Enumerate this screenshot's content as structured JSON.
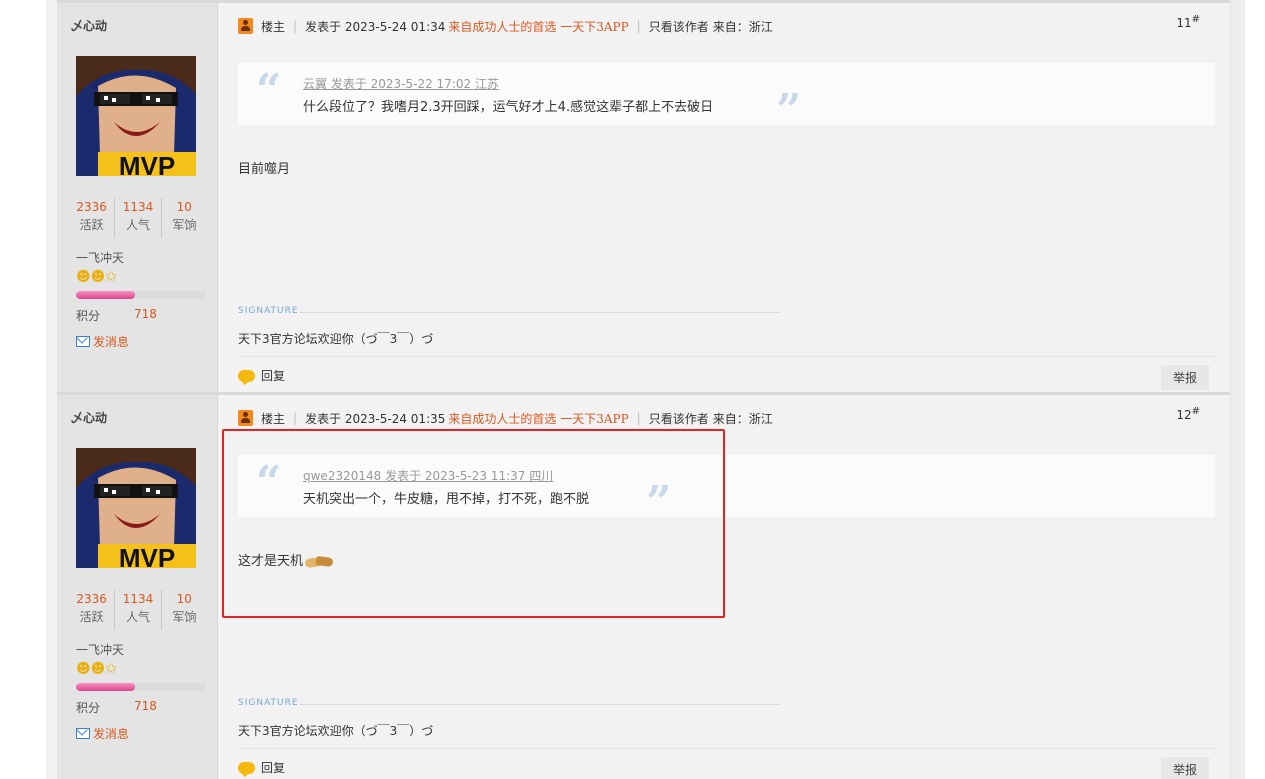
{
  "posts": [
    {
      "author": {
        "name": "乄心动",
        "stats": [
          {
            "value": "2336",
            "label": "活跃"
          },
          {
            "value": "1134",
            "label": "人气"
          },
          {
            "value": "10",
            "label": "军饷"
          }
        ],
        "rank_title": "一飞冲天",
        "rank_icons": "☻☻✩",
        "rank_progress_percent": 45,
        "score_label": "积分",
        "score_value": "718",
        "send_message": "发消息",
        "avatar_text": "MVP"
      },
      "owner_label": "楼主",
      "posted_at": "发表于 2023-5-24 01:34",
      "ad_text": "来自成功人士的首选 一天下3APP",
      "author_only": "只看该作者",
      "location": "来自：浙江",
      "floor_number": "11",
      "floor_mark": "#",
      "quote": {
        "meta": "云翼 发表于 2023-5-22 17:02 江苏",
        "text": "什么段位了？我嗜月2.3开回踩，运气好才上4.感觉这辈子都上不去破日"
      },
      "body": "目前噬月",
      "signature_label": "SIGNATURE",
      "signature": "天下3官方论坛欢迎你（づ￣3￣）づ",
      "reply_label": "回复",
      "report_label": "举报"
    },
    {
      "author": {
        "name": "乄心动",
        "stats": [
          {
            "value": "2336",
            "label": "活跃"
          },
          {
            "value": "1134",
            "label": "人气"
          },
          {
            "value": "10",
            "label": "军饷"
          }
        ],
        "rank_title": "一飞冲天",
        "rank_icons": "☻☻✩",
        "rank_progress_percent": 45,
        "score_label": "积分",
        "score_value": "718",
        "send_message": "发消息",
        "avatar_text": "MVP"
      },
      "owner_label": "楼主",
      "posted_at": "发表于 2023-5-24 01:35",
      "ad_text": "来自成功人士的首选 一天下3APP",
      "author_only": "只看该作者",
      "location": "来自：浙江",
      "floor_number": "12",
      "floor_mark": "#",
      "quote": {
        "meta": "qwe2320148 发表于 2023-5-23 11:37 四川",
        "text": "天机突出一个，牛皮糖，甩不掉，打不死，跑不脱"
      },
      "body": "这才是天机",
      "signature_label": "SIGNATURE",
      "signature": "天下3官方论坛欢迎你（づ￣3￣）づ",
      "reply_label": "回复",
      "report_label": "举报"
    }
  ],
  "colors": {
    "accent": "#d8581f",
    "highlight_border": "#e02424",
    "quote_mark": "#c9d9ea"
  }
}
